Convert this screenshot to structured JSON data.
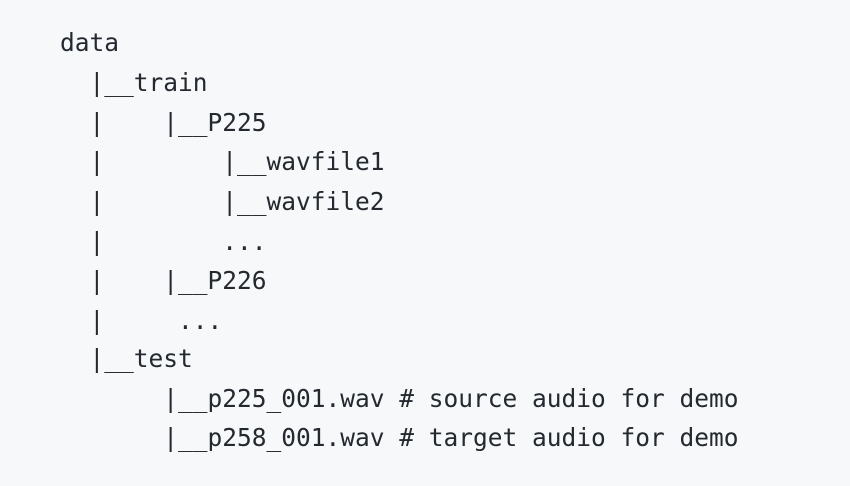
{
  "code_block": {
    "lines": [
      "data",
      "  |__train",
      "  |    |__P225",
      "  |        |__wavfile1",
      "  |        |__wavfile2",
      "  |        ...",
      "  |    |__P226",
      "  |     ...",
      "  |__test",
      "       |__p225_001.wav # source audio for demo",
      "       |__p258_001.wav # target audio for demo"
    ]
  }
}
